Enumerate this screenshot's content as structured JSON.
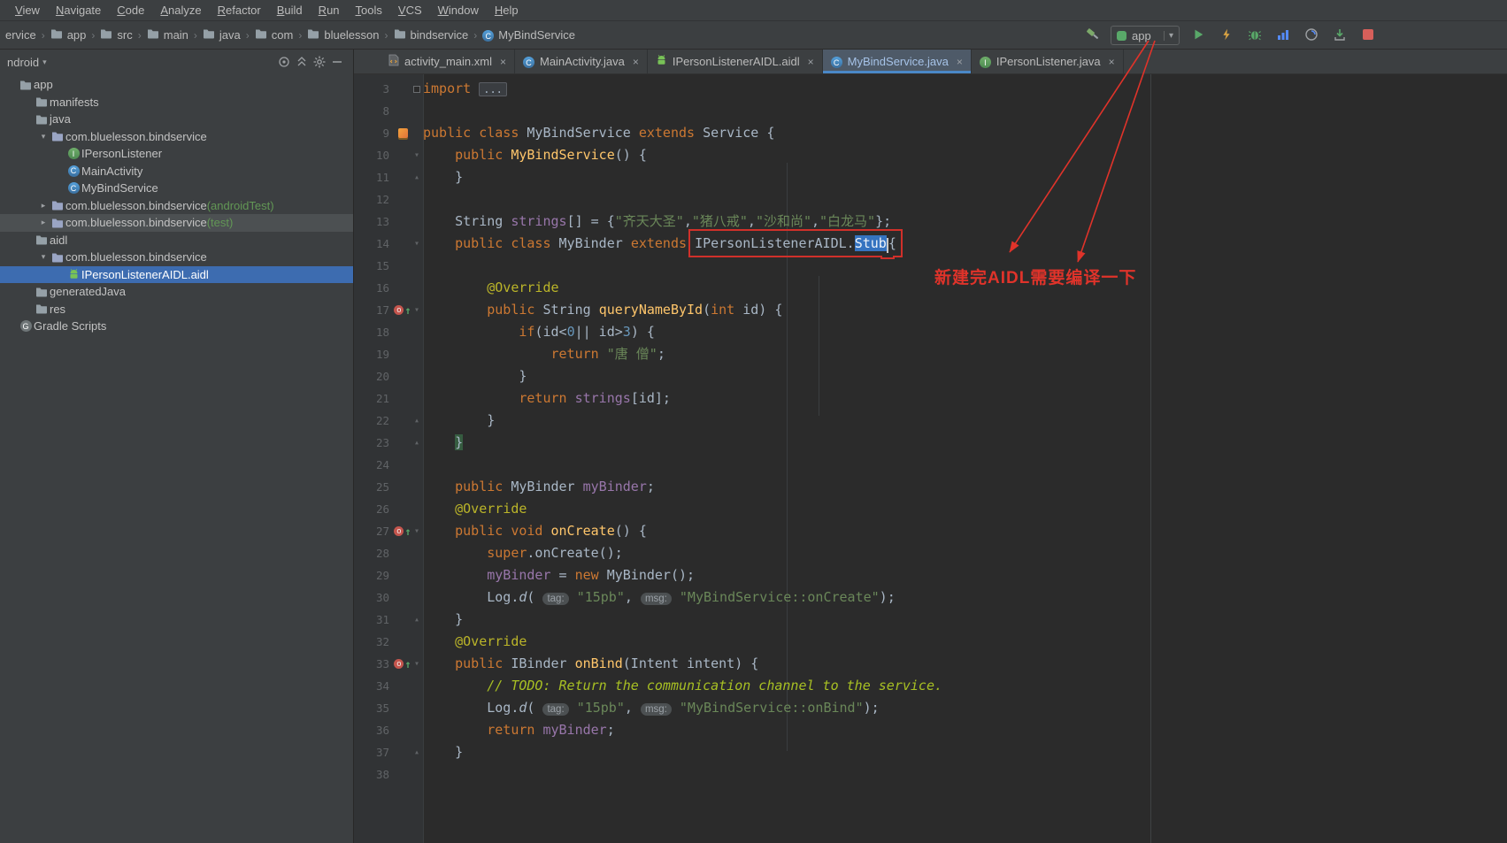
{
  "menu": {
    "items": [
      "View",
      "Navigate",
      "Code",
      "Analyze",
      "Refactor",
      "Build",
      "Run",
      "Tools",
      "VCS",
      "Window",
      "Help"
    ]
  },
  "breadcrumbs": {
    "items": [
      {
        "label": "ervice"
      },
      {
        "label": "app",
        "icon": "folder"
      },
      {
        "label": "src",
        "icon": "folder"
      },
      {
        "label": "main",
        "icon": "folder"
      },
      {
        "label": "java",
        "icon": "folder"
      },
      {
        "label": "com",
        "icon": "folder"
      },
      {
        "label": "bluelesson",
        "icon": "folder"
      },
      {
        "label": "bindservice",
        "icon": "folder"
      },
      {
        "label": "MyBindService",
        "icon": "class"
      }
    ]
  },
  "toolbar": {
    "run_config": "app",
    "buttons": [
      "build",
      "run",
      "apply-changes",
      "debug",
      "profiler",
      "profile",
      "attach-debugger",
      "stop"
    ]
  },
  "project": {
    "view_selector": "ndroid",
    "header_icons": [
      "locate",
      "collapse-all",
      "settings",
      "hide"
    ],
    "items": [
      {
        "label": "app",
        "icon": "folder",
        "indent": 0
      },
      {
        "label": "manifests",
        "icon": "folder",
        "indent": 1
      },
      {
        "label": "java",
        "icon": "folder",
        "indent": 1
      },
      {
        "label": "com.bluelesson.bindservice",
        "icon": "package",
        "indent": 2,
        "chev": "open"
      },
      {
        "label": "IPersonListener",
        "icon": "interface",
        "indent": 3
      },
      {
        "label": "MainActivity",
        "icon": "class",
        "indent": 3
      },
      {
        "label": "MyBindService",
        "icon": "class",
        "indent": 3
      },
      {
        "label": "com.bluelesson.bindservice",
        "suffix": " (androidTest)",
        "icon": "package",
        "indent": 2,
        "chev": "closed"
      },
      {
        "label": "com.bluelesson.bindservice",
        "suffix": " (test)",
        "icon": "package",
        "indent": 2,
        "chev": "closed",
        "state": "hover"
      },
      {
        "label": "aidl",
        "icon": "folder",
        "indent": 1
      },
      {
        "label": "com.bluelesson.bindservice",
        "icon": "package",
        "indent": 2,
        "chev": "open"
      },
      {
        "label": "IPersonListenerAIDL.aidl",
        "icon": "android",
        "indent": 3,
        "state": "selected"
      },
      {
        "label": "generatedJava",
        "icon": "folder",
        "indent": 1
      },
      {
        "label": "res",
        "icon": "folder",
        "indent": 1
      },
      {
        "label": "Gradle Scripts",
        "icon": "gradle",
        "indent": 0
      }
    ]
  },
  "tabs": [
    {
      "label": "activity_main.xml",
      "icon": "xml"
    },
    {
      "label": "MainActivity.java",
      "icon": "class"
    },
    {
      "label": "IPersonListenerAIDL.aidl",
      "icon": "android"
    },
    {
      "label": "MyBindService.java",
      "icon": "class",
      "active": true
    },
    {
      "label": "IPersonListener.java",
      "icon": "interface"
    }
  ],
  "editor": {
    "lines": [
      {
        "n": "3",
        "fold": "expand",
        "segs": [
          [
            "kw",
            "import "
          ],
          [
            "foldb",
            "..."
          ]
        ]
      },
      {
        "n": "8",
        "segs": []
      },
      {
        "n": "9",
        "g": "android",
        "segs": [
          [
            "kw",
            "public class "
          ],
          [
            "pln",
            "MyBindService "
          ],
          [
            "kw",
            "extends "
          ],
          [
            "pln",
            "Service {"
          ]
        ]
      },
      {
        "n": "10",
        "fold": "open",
        "segs": [
          [
            "pln",
            "    "
          ],
          [
            "kw",
            "public "
          ],
          [
            "mth",
            "MyBindService"
          ],
          [
            "pln",
            "() {"
          ]
        ]
      },
      {
        "n": "11",
        "fold": "close",
        "segs": [
          [
            "pln",
            "    }"
          ]
        ]
      },
      {
        "n": "12",
        "segs": []
      },
      {
        "n": "13",
        "segs": [
          [
            "pln",
            "    String "
          ],
          [
            "fld",
            "strings"
          ],
          [
            "pln",
            "[] = {"
          ],
          [
            "str",
            "\"齐天大圣\""
          ],
          [
            "pln",
            ","
          ],
          [
            "str",
            "\"猪八戒\""
          ],
          [
            "pln",
            ","
          ],
          [
            "str",
            "\"沙和尚\""
          ],
          [
            "pln",
            ","
          ],
          [
            "str",
            "\"白龙马\""
          ],
          [
            "pln",
            "};"
          ]
        ]
      },
      {
        "n": "14",
        "fold": "open",
        "segs": [
          [
            "pln",
            "    "
          ],
          [
            "kw",
            "public class "
          ],
          [
            "pln",
            "MyBinder "
          ],
          [
            "kw",
            "extends "
          ],
          [
            "pln",
            "IPersonListenerAIDL.",
            1
          ],
          [
            "sel",
            "Stub",
            1
          ],
          [
            "caret",
            "",
            1
          ],
          [
            "pln",
            "{",
            1
          ]
        ]
      },
      {
        "n": "15",
        "segs": []
      },
      {
        "n": "16",
        "segs": [
          [
            "pln",
            "        "
          ],
          [
            "ann",
            "@Override"
          ]
        ]
      },
      {
        "n": "17",
        "g": "override",
        "fold": "open",
        "segs": [
          [
            "pln",
            "        "
          ],
          [
            "kw",
            "public "
          ],
          [
            "pln",
            "String "
          ],
          [
            "mth",
            "queryNameById"
          ],
          [
            "pln",
            "("
          ],
          [
            "kw",
            "int"
          ],
          [
            "pln",
            " id) {"
          ]
        ]
      },
      {
        "n": "18",
        "segs": [
          [
            "pln",
            "            "
          ],
          [
            "kw",
            "if"
          ],
          [
            "pln",
            "(id<"
          ],
          [
            "num",
            "0"
          ],
          [
            "pln",
            "|| id>"
          ],
          [
            "num",
            "3"
          ],
          [
            "pln",
            ") {"
          ]
        ]
      },
      {
        "n": "19",
        "segs": [
          [
            "pln",
            "                "
          ],
          [
            "kw",
            "return "
          ],
          [
            "str",
            "\"唐 僧\""
          ],
          [
            "pln",
            ";"
          ]
        ]
      },
      {
        "n": "20",
        "segs": [
          [
            "pln",
            "            }"
          ]
        ]
      },
      {
        "n": "21",
        "segs": [
          [
            "pln",
            "            "
          ],
          [
            "kw",
            "return "
          ],
          [
            "fld",
            "strings"
          ],
          [
            "pln",
            "[id];"
          ]
        ]
      },
      {
        "n": "22",
        "fold": "close",
        "segs": [
          [
            "pln",
            "        }"
          ]
        ]
      },
      {
        "n": "23",
        "fold": "close",
        "segs": [
          [
            "pln",
            "    "
          ],
          [
            "brace",
            "}"
          ]
        ]
      },
      {
        "n": "24",
        "segs": []
      },
      {
        "n": "25",
        "segs": [
          [
            "pln",
            "    "
          ],
          [
            "kw",
            "public "
          ],
          [
            "pln",
            "MyBinder "
          ],
          [
            "fld",
            "myBinder"
          ],
          [
            "pln",
            ";"
          ]
        ]
      },
      {
        "n": "26",
        "segs": [
          [
            "pln",
            "    "
          ],
          [
            "ann",
            "@Override"
          ]
        ]
      },
      {
        "n": "27",
        "g": "override",
        "fold": "open",
        "segs": [
          [
            "pln",
            "    "
          ],
          [
            "kw",
            "public void "
          ],
          [
            "mth",
            "onCreate"
          ],
          [
            "pln",
            "() {"
          ]
        ]
      },
      {
        "n": "28",
        "segs": [
          [
            "pln",
            "        "
          ],
          [
            "kw",
            "super"
          ],
          [
            "pln",
            ".onCreate();"
          ]
        ]
      },
      {
        "n": "29",
        "segs": [
          [
            "pln",
            "        "
          ],
          [
            "fld",
            "myBinder"
          ],
          [
            "pln",
            " = "
          ],
          [
            "kw",
            "new "
          ],
          [
            "pln",
            "MyBinder();"
          ]
        ]
      },
      {
        "n": "30",
        "segs": [
          [
            "pln",
            "        Log."
          ],
          [
            "itl",
            "d"
          ],
          [
            "pln",
            "( "
          ],
          [
            "hint",
            "tag:"
          ],
          [
            "pln",
            " "
          ],
          [
            "str",
            "\"15pb\""
          ],
          [
            "pln",
            ", "
          ],
          [
            "hint",
            "msg:"
          ],
          [
            "pln",
            " "
          ],
          [
            "str",
            "\"MyBindService::onCreate\""
          ],
          [
            "pln",
            ");"
          ]
        ]
      },
      {
        "n": "31",
        "fold": "close",
        "segs": [
          [
            "pln",
            "    }"
          ]
        ]
      },
      {
        "n": "32",
        "segs": [
          [
            "pln",
            "    "
          ],
          [
            "ann",
            "@Override"
          ]
        ]
      },
      {
        "n": "33",
        "g": "override",
        "fold": "open",
        "segs": [
          [
            "pln",
            "    "
          ],
          [
            "kw",
            "public "
          ],
          [
            "pln",
            "IBinder "
          ],
          [
            "mth",
            "onBind"
          ],
          [
            "pln",
            "(Intent intent) {"
          ]
        ]
      },
      {
        "n": "34",
        "segs": [
          [
            "pln",
            "        "
          ],
          [
            "todo",
            "// TODO: Return the communication channel to the service."
          ]
        ]
      },
      {
        "n": "35",
        "segs": [
          [
            "pln",
            "        Log."
          ],
          [
            "itl",
            "d"
          ],
          [
            "pln",
            "( "
          ],
          [
            "hint",
            "tag:"
          ],
          [
            "pln",
            " "
          ],
          [
            "str",
            "\"15pb\""
          ],
          [
            "pln",
            ", "
          ],
          [
            "hint",
            "msg:"
          ],
          [
            "pln",
            " "
          ],
          [
            "str",
            "\"MyBindService::onBind\""
          ],
          [
            "pln",
            ");"
          ]
        ]
      },
      {
        "n": "36",
        "segs": [
          [
            "pln",
            "        "
          ],
          [
            "kw",
            "return "
          ],
          [
            "fld",
            "myBinder"
          ],
          [
            "pln",
            ";"
          ]
        ]
      },
      {
        "n": "37",
        "fold": "close",
        "segs": [
          [
            "pln",
            "    }"
          ]
        ]
      },
      {
        "n": "38",
        "segs": []
      }
    ]
  },
  "annotation": {
    "note": "新建完AIDL需要编译一下"
  },
  "colors": {
    "annotation_red": "#e0332a",
    "selection_blue": "#3573c0",
    "tree_selection_blue": "#3d6cb0",
    "run_green": "#59A869",
    "stop_red": "#D75F5A",
    "accent_blue": "#4A88C7"
  }
}
